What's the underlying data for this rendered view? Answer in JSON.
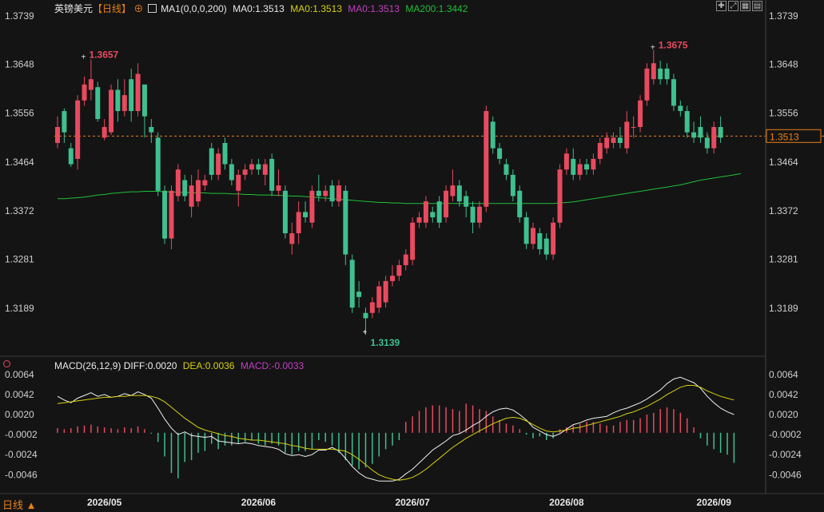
{
  "header": {
    "symbol": "英镑美元",
    "period": "【日线】",
    "ma_label": "MA1(0,0,0,200)",
    "ma0a": "MA0:1.3513",
    "ma0b": "MA0:1.3513",
    "ma0c": "MA0:1.3513",
    "ma200": "MA200:1.3442"
  },
  "macd_header": {
    "name": "MACD(26,12,9)",
    "diff": "DIFF:0.0020",
    "dea": "DEA:0.0036",
    "macd": "MACD:-0.0033"
  },
  "footer": {
    "period_button": "日线"
  },
  "colors": {
    "background": "#141414",
    "up": "#e84a5f",
    "down": "#3ec08f",
    "ma200": "#1fbf3a",
    "diff": "#f0f0f0",
    "dea": "#d8d010",
    "macd": "#c040c0",
    "last_price": "#e8801a"
  },
  "toolbar_icons": [
    "crosshair-icon",
    "fit-icon",
    "grid-icon",
    "settings-icon"
  ],
  "chart_data": [
    {
      "type": "candlestick",
      "title": "英镑美元 日线",
      "price_ylim": [
        1.31,
        1.3739
      ],
      "y_ticks": [
        "1.3739",
        "1.3648",
        "1.3556",
        "1.3464",
        "1.3372",
        "1.3281",
        "1.3189"
      ],
      "x_ticks": [
        {
          "label": "2026/05",
          "index": 7
        },
        {
          "label": "2026/06",
          "index": 30
        },
        {
          "label": "2026/07",
          "index": 53
        },
        {
          "label": "2026/08",
          "index": 76
        },
        {
          "label": "2026/09",
          "index": 98
        }
      ],
      "last_price": 1.3513,
      "annotations": [
        {
          "text": "1.3657",
          "index": 4,
          "value": 1.3657,
          "color": "#e84a5f"
        },
        {
          "text": "1.3139",
          "index": 46,
          "value": 1.3139,
          "color": "#3ec08f"
        },
        {
          "text": "1.3675",
          "index": 89,
          "value": 1.3675,
          "color": "#e84a5f"
        }
      ],
      "candles": [
        [
          1.35,
          1.353,
          1.349,
          1.355
        ],
        [
          1.356,
          1.352,
          1.35,
          1.3565
        ],
        [
          1.349,
          1.346,
          1.3455,
          1.35
        ],
        [
          1.347,
          1.358,
          1.345,
          1.359
        ],
        [
          1.358,
          1.361,
          1.357,
          1.3625
        ],
        [
          1.36,
          1.362,
          1.358,
          1.3657
        ],
        [
          1.3605,
          1.3545,
          1.354,
          1.3615
        ],
        [
          1.351,
          1.353,
          1.3505,
          1.3545
        ],
        [
          1.352,
          1.36,
          1.3515,
          1.361
        ],
        [
          1.36,
          1.356,
          1.354,
          1.362
        ],
        [
          1.356,
          1.359,
          1.355,
          1.362
        ],
        [
          1.362,
          1.356,
          1.354,
          1.364
        ],
        [
          1.356,
          1.363,
          1.355,
          1.365
        ],
        [
          1.361,
          1.355,
          1.351,
          1.361
        ],
        [
          1.353,
          1.352,
          1.35,
          1.3545
        ],
        [
          1.351,
          1.341,
          1.34,
          1.352
        ],
        [
          1.341,
          1.332,
          1.331,
          1.342
        ],
        [
          1.332,
          1.341,
          1.33,
          1.342
        ],
        [
          1.34,
          1.345,
          1.339,
          1.346
        ],
        [
          1.343,
          1.34,
          1.339,
          1.344
        ],
        [
          1.338,
          1.342,
          1.336,
          1.344
        ],
        [
          1.339,
          1.343,
          1.338,
          1.345
        ],
        [
          1.342,
          1.343,
          1.341,
          1.344
        ],
        [
          1.349,
          1.344,
          1.343,
          1.35
        ],
        [
          1.344,
          1.348,
          1.343,
          1.349
        ],
        [
          1.35,
          1.346,
          1.345,
          1.351
        ],
        [
          1.346,
          1.343,
          1.342,
          1.347
        ],
        [
          1.341,
          1.344,
          1.338,
          1.345
        ],
        [
          1.344,
          1.345,
          1.343,
          1.346
        ],
        [
          1.345,
          1.346,
          1.344,
          1.347
        ],
        [
          1.346,
          1.345,
          1.344,
          1.347
        ],
        [
          1.344,
          1.346,
          1.342,
          1.347
        ],
        [
          1.347,
          1.341,
          1.34,
          1.348
        ],
        [
          1.341,
          1.342,
          1.34,
          1.345
        ],
        [
          1.341,
          1.333,
          1.332,
          1.342
        ],
        [
          1.331,
          1.333,
          1.329,
          1.335
        ],
        [
          1.333,
          1.337,
          1.331,
          1.339
        ],
        [
          1.337,
          1.336,
          1.335,
          1.339
        ],
        [
          1.335,
          1.341,
          1.334,
          1.342
        ],
        [
          1.341,
          1.34,
          1.339,
          1.344
        ],
        [
          1.34,
          1.341,
          1.339,
          1.342
        ],
        [
          1.342,
          1.339,
          1.338,
          1.343
        ],
        [
          1.339,
          1.342,
          1.338,
          1.343
        ],
        [
          1.341,
          1.329,
          1.327,
          1.342
        ],
        [
          1.328,
          1.319,
          1.318,
          1.329
        ],
        [
          1.322,
          1.321,
          1.319,
          1.324
        ],
        [
          1.318,
          1.317,
          1.3139,
          1.319
        ],
        [
          1.318,
          1.32,
          1.317,
          1.321
        ],
        [
          1.319,
          1.323,
          1.318,
          1.324
        ],
        [
          1.32,
          1.324,
          1.319,
          1.325
        ],
        [
          1.324,
          1.325,
          1.323,
          1.327
        ],
        [
          1.325,
          1.327,
          1.324,
          1.328
        ],
        [
          1.327,
          1.329,
          1.326,
          1.33
        ],
        [
          1.328,
          1.335,
          1.327,
          1.336
        ],
        [
          1.335,
          1.336,
          1.334,
          1.337
        ],
        [
          1.335,
          1.339,
          1.334,
          1.34
        ],
        [
          1.337,
          1.336,
          1.335,
          1.338
        ],
        [
          1.339,
          1.335,
          1.334,
          1.34
        ],
        [
          1.336,
          1.341,
          1.335,
          1.342
        ],
        [
          1.34,
          1.342,
          1.339,
          1.345
        ],
        [
          1.342,
          1.339,
          1.338,
          1.343
        ],
        [
          1.34,
          1.338,
          1.336,
          1.341
        ],
        [
          1.338,
          1.335,
          1.333,
          1.339
        ],
        [
          1.335,
          1.338,
          1.334,
          1.339
        ],
        [
          1.338,
          1.356,
          1.337,
          1.357
        ],
        [
          1.354,
          1.349,
          1.348,
          1.355
        ],
        [
          1.349,
          1.347,
          1.346,
          1.35
        ],
        [
          1.346,
          1.344,
          1.343,
          1.347
        ],
        [
          1.344,
          1.34,
          1.339,
          1.345
        ],
        [
          1.341,
          1.336,
          1.335,
          1.342
        ],
        [
          1.336,
          1.331,
          1.33,
          1.337
        ],
        [
          1.331,
          1.334,
          1.33,
          1.335
        ],
        [
          1.333,
          1.33,
          1.329,
          1.334
        ],
        [
          1.332,
          1.329,
          1.328,
          1.333
        ],
        [
          1.329,
          1.335,
          1.328,
          1.336
        ],
        [
          1.335,
          1.345,
          1.334,
          1.346
        ],
        [
          1.345,
          1.348,
          1.344,
          1.349
        ],
        [
          1.347,
          1.344,
          1.343,
          1.349
        ],
        [
          1.344,
          1.346,
          1.343,
          1.347
        ],
        [
          1.346,
          1.345,
          1.344,
          1.347
        ],
        [
          1.345,
          1.347,
          1.344,
          1.348
        ],
        [
          1.347,
          1.35,
          1.346,
          1.351
        ],
        [
          1.349,
          1.351,
          1.348,
          1.352
        ],
        [
          1.35,
          1.351,
          1.349,
          1.352
        ],
        [
          1.351,
          1.35,
          1.349,
          1.353
        ],
        [
          1.349,
          1.354,
          1.348,
          1.356
        ],
        [
          1.353,
          1.353,
          1.351,
          1.355
        ],
        [
          1.353,
          1.358,
          1.352,
          1.359
        ],
        [
          1.358,
          1.364,
          1.357,
          1.365
        ],
        [
          1.362,
          1.365,
          1.361,
          1.3675
        ],
        [
          1.364,
          1.362,
          1.361,
          1.3655
        ],
        [
          1.364,
          1.362,
          1.361,
          1.365
        ],
        [
          1.362,
          1.357,
          1.356,
          1.363
        ],
        [
          1.357,
          1.356,
          1.355,
          1.358
        ],
        [
          1.356,
          1.352,
          1.351,
          1.357
        ],
        [
          1.352,
          1.351,
          1.35,
          1.354
        ],
        [
          1.353,
          1.351,
          1.35,
          1.355
        ],
        [
          1.351,
          1.349,
          1.348,
          1.352
        ],
        [
          1.349,
          1.353,
          1.348,
          1.354
        ],
        [
          1.353,
          1.351,
          1.35,
          1.355
        ]
      ],
      "series": [
        {
          "name": "MA200",
          "values": [
            1.3395,
            1.3395,
            1.3396,
            1.3397,
            1.3398,
            1.34,
            1.3402,
            1.3403,
            1.3405,
            1.3406,
            1.3407,
            1.3408,
            1.3408,
            1.3409,
            1.3409,
            1.3409,
            1.3408,
            1.3408,
            1.3407,
            1.3407,
            1.3406,
            1.3406,
            1.3406,
            1.3405,
            1.3405,
            1.3405,
            1.3404,
            1.3404,
            1.3403,
            1.3403,
            1.3402,
            1.3402,
            1.3402,
            1.3401,
            1.3401,
            1.34,
            1.34,
            1.3399,
            1.3398,
            1.3397,
            1.3396,
            1.3395,
            1.3394,
            1.3393,
            1.3392,
            1.3391,
            1.339,
            1.3389,
            1.3388,
            1.3388,
            1.3387,
            1.3387,
            1.3386,
            1.3386,
            1.3386,
            1.3386,
            1.3386,
            1.3386,
            1.3386,
            1.3386,
            1.3386,
            1.3386,
            1.3386,
            1.3386,
            1.3386,
            1.3386,
            1.3386,
            1.3386,
            1.3386,
            1.3386,
            1.3386,
            1.3386,
            1.3386,
            1.3386,
            1.3386,
            1.3387,
            1.3388,
            1.3389,
            1.3391,
            1.3393,
            1.3395,
            1.3397,
            1.3399,
            1.3401,
            1.3403,
            1.3405,
            1.3407,
            1.3409,
            1.3411,
            1.3413,
            1.3415,
            1.3417,
            1.3419,
            1.3421,
            1.3424,
            1.3427,
            1.343,
            1.3432,
            1.3434,
            1.3436,
            1.3438,
            1.344,
            1.3442
          ]
        }
      ]
    },
    {
      "type": "macd",
      "title": "MACD(26,12,9)",
      "ylim": [
        -0.0058,
        0.007
      ],
      "y_ticks": [
        "0.0064",
        "0.0042",
        "0.0020",
        "-0.0002",
        "-0.0024",
        "-0.0046"
      ],
      "series": [
        {
          "name": "DIFF",
          "values": [
            0.004,
            0.0036,
            0.0033,
            0.0038,
            0.0041,
            0.0044,
            0.004,
            0.0042,
            0.0039,
            0.004,
            0.0043,
            0.0041,
            0.0045,
            0.0042,
            0.0038,
            0.0027,
            0.0015,
            0.0005,
            -0.0002,
            0.0001,
            -0.0003,
            -0.0004,
            -0.0005,
            -0.0004,
            -0.0009,
            -0.001,
            -0.0011,
            -0.0012,
            -0.0011,
            -0.0012,
            -0.0014,
            -0.0015,
            -0.0016,
            -0.0018,
            -0.0023,
            -0.0025,
            -0.0024,
            -0.0026,
            -0.0024,
            -0.0019,
            -0.0019,
            -0.0016,
            -0.002,
            -0.0028,
            -0.0037,
            -0.0044,
            -0.0049,
            -0.0051,
            -0.0053,
            -0.0053,
            -0.0053,
            -0.0051,
            -0.0045,
            -0.004,
            -0.0033,
            -0.0026,
            -0.0019,
            -0.0014,
            -0.0009,
            -0.0003,
            -0.0001,
            0.0003,
            0.0008,
            0.0012,
            0.0018,
            0.0023,
            0.0026,
            0.0027,
            0.0025,
            0.002,
            0.0014,
            0.0006,
            0.0002,
            -0.0002,
            -0.0004,
            -0.0001,
            0.0004,
            0.0009,
            0.0011,
            0.0014,
            0.0016,
            0.0017,
            0.0018,
            0.0022,
            0.0025,
            0.0027,
            0.003,
            0.0033,
            0.0037,
            0.0042,
            0.0047,
            0.0054,
            0.0059,
            0.0061,
            0.0058,
            0.0055,
            0.0049,
            0.004,
            0.0033,
            0.0027,
            0.0023,
            0.002
          ]
        },
        {
          "name": "DEA",
          "values": [
            0.0032,
            0.0033,
            0.0034,
            0.0035,
            0.0036,
            0.0037,
            0.0038,
            0.0039,
            0.0039,
            0.004,
            0.004,
            0.0041,
            0.0041,
            0.0041,
            0.004,
            0.0038,
            0.0034,
            0.0028,
            0.0022,
            0.0016,
            0.0011,
            0.0006,
            0.0003,
            0.0001,
            -0.0001,
            -0.0003,
            -0.0004,
            -0.0006,
            -0.0007,
            -0.0008,
            -0.0008,
            -0.0009,
            -0.001,
            -0.0011,
            -0.0012,
            -0.0014,
            -0.0015,
            -0.0017,
            -0.0018,
            -0.0018,
            -0.0018,
            -0.0018,
            -0.0019,
            -0.002,
            -0.0024,
            -0.0029,
            -0.0035,
            -0.0041,
            -0.0046,
            -0.0049,
            -0.0051,
            -0.0052,
            -0.0051,
            -0.0049,
            -0.0045,
            -0.004,
            -0.0034,
            -0.0028,
            -0.0022,
            -0.0016,
            -0.0011,
            -0.0006,
            -0.0002,
            0.0002,
            0.0006,
            0.001,
            0.0013,
            0.0016,
            0.0017,
            0.0016,
            0.0013,
            0.0009,
            0.0005,
            0.0002,
            0.0001,
            0.0002,
            0.0003,
            0.0005,
            0.0006,
            0.0008,
            0.001,
            0.0012,
            0.0014,
            0.0016,
            0.0018,
            0.0021,
            0.0023,
            0.0026,
            0.0029,
            0.0033,
            0.0037,
            0.0042,
            0.0046,
            0.005,
            0.0052,
            0.0052,
            0.005,
            0.0046,
            0.0043,
            0.004,
            0.0038,
            0.0036
          ]
        },
        {
          "name": "MACD",
          "values": [
            0.0005,
            0.0004,
            0.0005,
            0.0007,
            0.0008,
            0.0009,
            0.0007,
            0.0006,
            0.0005,
            0.0004,
            0.0006,
            0.0005,
            0.0007,
            0.0004,
            -0.0001,
            -0.001,
            -0.0026,
            -0.0044,
            -0.005,
            -0.0032,
            -0.003,
            -0.0022,
            -0.002,
            -0.0012,
            -0.0018,
            -0.0014,
            -0.0014,
            -0.0012,
            -0.001,
            -0.0008,
            -0.0012,
            -0.0014,
            -0.0012,
            -0.0014,
            -0.0022,
            -0.0024,
            -0.002,
            -0.002,
            -0.0018,
            -0.0008,
            -0.001,
            -0.0014,
            -0.0022,
            -0.003,
            -0.0036,
            -0.004,
            -0.0038,
            -0.0034,
            -0.0026,
            -0.0018,
            -0.0014,
            -0.0008,
            0.0012,
            0.0018,
            0.0024,
            0.0028,
            0.003,
            0.003,
            0.0028,
            0.0026,
            0.0024,
            0.0032,
            0.003,
            0.0026,
            0.0024,
            0.0018,
            0.0014,
            0.001,
            0.0008,
            0.0004,
            -0.0002,
            -0.0006,
            -0.0004,
            -0.0008,
            -0.0006,
            0.0004,
            0.0006,
            0.0008,
            0.001,
            0.0012,
            0.0012,
            0.001,
            0.0008,
            0.0008,
            0.0012,
            0.0014,
            0.0014,
            0.0016,
            0.002,
            0.0022,
            0.0026,
            0.0028,
            0.0026,
            0.0022,
            0.0016,
            0.0006,
            -0.0006,
            -0.0014,
            -0.0018,
            -0.0022,
            -0.0024,
            -0.0033
          ]
        }
      ]
    }
  ]
}
